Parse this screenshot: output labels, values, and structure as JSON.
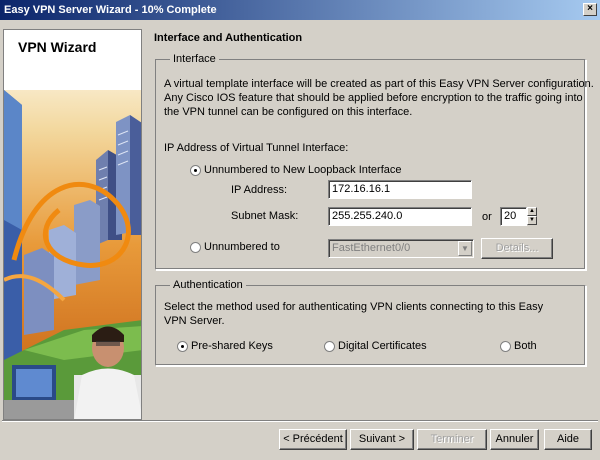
{
  "window": {
    "title": "Easy VPN Server Wizard - 10% Complete",
    "close_glyph": "×"
  },
  "sidebar": {
    "title": "VPN Wizard"
  },
  "page": {
    "title": "Interface and Authentication",
    "interface": {
      "legend": "Interface",
      "description": [
        "A virtual template interface will be created as part of this Easy VPN Server configuration.",
        "Any Cisco IOS feature that should be applied before encryption to the traffic going into",
        "the VPN tunnel can be configured on this interface."
      ],
      "ip_section_label": "IP Address of Virtual Tunnel Interface:",
      "option_loopback": {
        "label": "Unnumbered to New Loopback Interface",
        "checked": true
      },
      "ip_label": "IP Address:",
      "ip_value": "172.16.16.1",
      "mask_label": "Subnet Mask:",
      "mask_value": "255.255.240.0",
      "or_label": "or",
      "prefix_value": "20",
      "option_unnumbered": {
        "label": "Unnumbered to",
        "checked": false
      },
      "interface_select": "FastEthernet0/0",
      "details_button": "Details..."
    },
    "authentication": {
      "legend": "Authentication",
      "description": [
        "Select the method used for authenticating VPN clients connecting to this Easy",
        "VPN Server."
      ],
      "options": [
        {
          "label": "Pre-shared Keys",
          "checked": true
        },
        {
          "label": "Digital Certificates",
          "checked": false
        },
        {
          "label": "Both",
          "checked": false
        }
      ]
    }
  },
  "buttons": {
    "back": "< Précédent",
    "next": "Suivant >",
    "finish": "Terminer",
    "cancel": "Annuler",
    "help": "Aide"
  }
}
